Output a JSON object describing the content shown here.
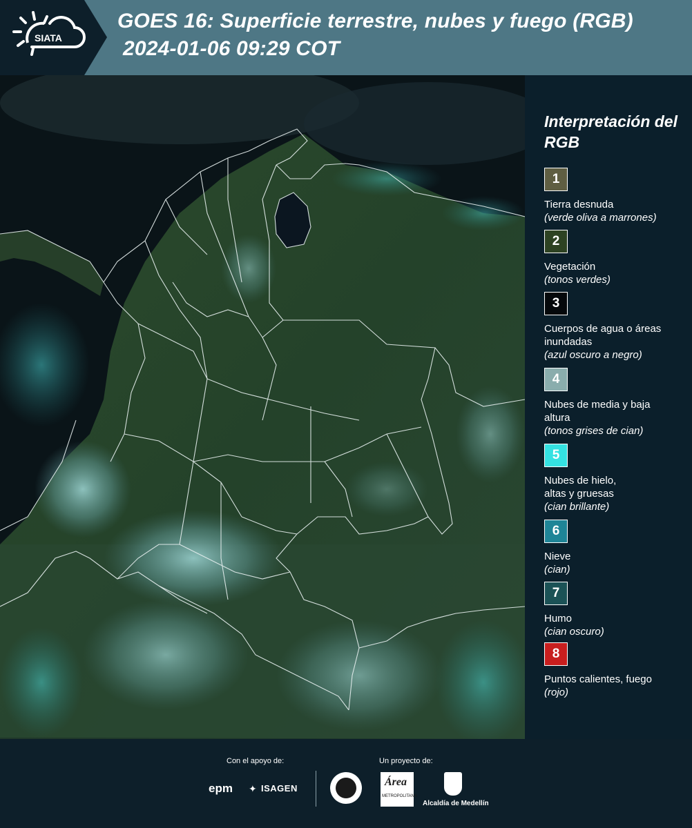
{
  "header": {
    "logo_text": "SIATA",
    "title_line1": "GOES 16: Superficie terrestre, nubes y fuego (RGB)",
    "title_line2": "2024-01-06 09:29 COT"
  },
  "legend": {
    "title": "Interpretación del RGB",
    "items": [
      {
        "num": "1",
        "color": "#5f5e42",
        "name": "Tierra desnuda",
        "desc": "(verde oliva a marrones)"
      },
      {
        "num": "2",
        "color": "#2d4222",
        "name": "Vegetación",
        "desc": "(tonos verdes)"
      },
      {
        "num": "3",
        "color": "#05080b",
        "name": "Cuerpos de agua o áreas inundadas",
        "desc": "(azul oscuro a negro)"
      },
      {
        "num": "4",
        "color": "#8aadad",
        "name": "Nubes de media y baja altura",
        "desc": "(tonos grises de cian)"
      },
      {
        "num": "5",
        "color": "#34e2e2",
        "name": "Nubes de hielo, altas y gruesas",
        "desc": "(cian brillante)"
      },
      {
        "num": "6",
        "color": "#1f8597",
        "name": "Nieve",
        "desc": "(cian)"
      },
      {
        "num": "7",
        "color": "#1b5256",
        "name": "Humo",
        "desc": "(cian oscuro)"
      },
      {
        "num": "8",
        "color": "#c81e1e",
        "name": "Puntos calientes, fuego",
        "desc": "(rojo)"
      }
    ]
  },
  "footer": {
    "support_label": "Con el apoyo de:",
    "project_label": "Un proyecto de:",
    "epm": "epm",
    "isagen": "ISAGEN",
    "area_name": "Área",
    "area_sub": "METROPOLITANA",
    "alcaldia": "Alcaldía de Medellín"
  }
}
